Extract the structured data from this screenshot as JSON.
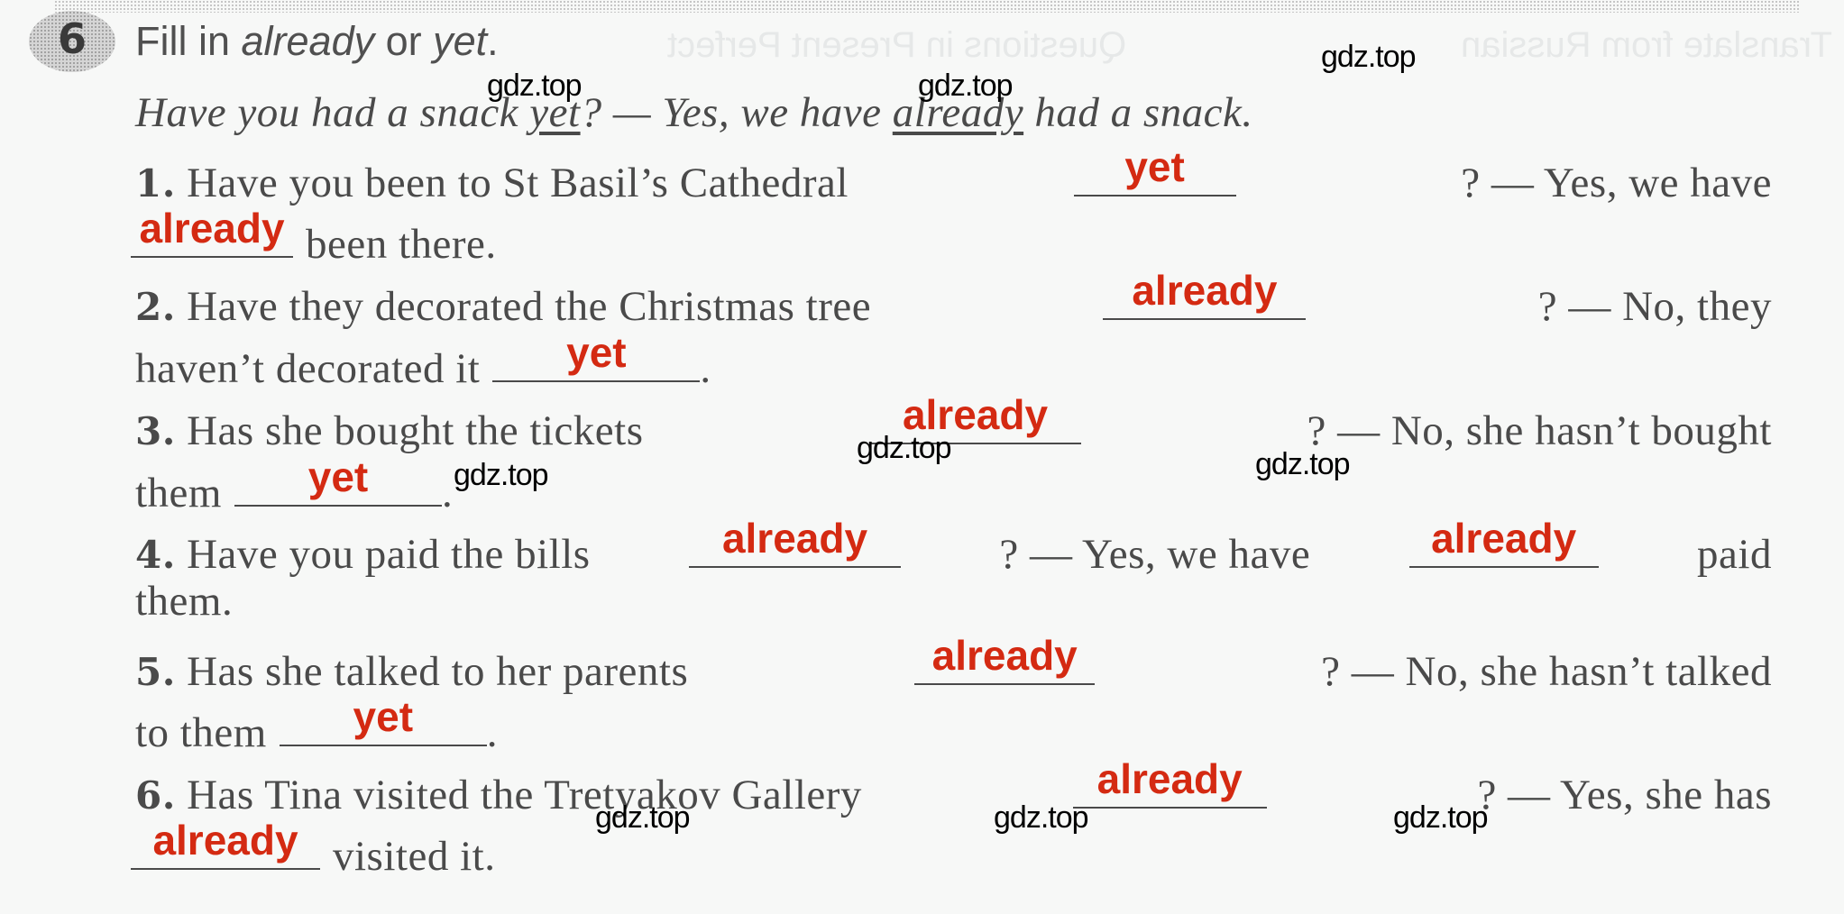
{
  "exercise": {
    "number": "6",
    "instruction_prefix": "Fill in ",
    "instruction_word1": "already",
    "instruction_mid": " or ",
    "instruction_word2": "yet",
    "instruction_end": "."
  },
  "example": {
    "part1": "Have you had a snack ",
    "word1": "yet",
    "part2": "? — Yes, we have ",
    "word2": "already",
    "part3": " had a snack."
  },
  "items": [
    {
      "number": "1.",
      "line1_text": "Have you been to St Basil’s Cathedral",
      "answer1": "yet",
      "line1_after": "? — Yes, we have",
      "answer2": "already",
      "line2_after": "been there."
    },
    {
      "number": "2.",
      "line1_text": "Have they decorated the Christmas tree",
      "answer1": "already",
      "line1_after": "? — No, they",
      "line2_before": "haven’t decorated it",
      "answer2": "yet",
      "line2_after": "."
    },
    {
      "number": "3.",
      "line1_text": "Has she bought the tickets",
      "answer1": "already",
      "line1_after": "? — No, she hasn’t bought",
      "line2_before": "them",
      "answer2": "yet",
      "line2_after": "."
    },
    {
      "number": "4.",
      "line1_text": "Have you paid the bills",
      "answer1": "already",
      "line1_mid": "? — Yes, we have",
      "answer2": "already",
      "line1_after": "paid",
      "line2_text": "them."
    },
    {
      "number": "5.",
      "line1_text": "Has she talked to her parents",
      "answer1": "already",
      "line1_after": "? — No, she hasn’t talked",
      "line2_before": "to them",
      "answer2": "yet",
      "line2_after": "."
    },
    {
      "number": "6.",
      "line1_text": "Has Tina visited the Tretyakov Gallery",
      "answer1": "already",
      "line1_after": "? — Yes, she has",
      "answer2": "already",
      "line2_after": "visited it."
    }
  ],
  "watermark": "gdz.top",
  "colors": {
    "answer": "#d42a12",
    "text": "#4a4a4a",
    "background": "#f7f8f7"
  }
}
